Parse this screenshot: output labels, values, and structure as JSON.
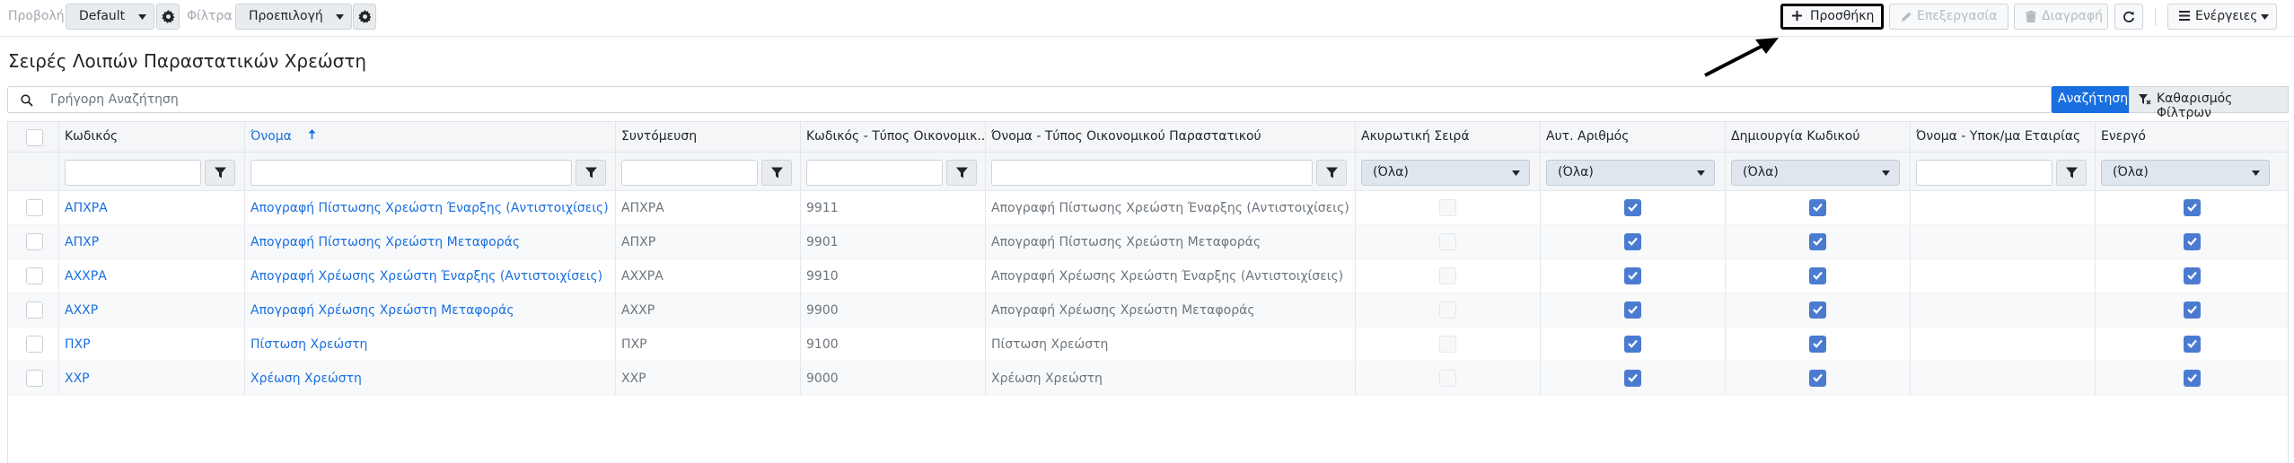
{
  "toolbar": {
    "view_label": "Προβολή",
    "view_value": "Default",
    "filter_label": "Φίλτρα",
    "filter_value": "Προεπιλογή",
    "add_label": "Προσθήκη",
    "edit_label": "Επεξεργασία",
    "delete_label": "Διαγραφή",
    "actions_label": "Ενέργειες"
  },
  "page": {
    "title": "Σειρές Λοιπών Παραστατικών Χρεώστη"
  },
  "search": {
    "placeholder": "Γρήγορη Αναζήτηση",
    "search_button": "Αναζήτηση",
    "clear_button": "Καθαρισμός Φίλτρων"
  },
  "table": {
    "columns": [
      "Κωδικός",
      "Όνομα",
      "Συντόμευση",
      "Κωδικός - Τύπος Οικονομικ...",
      "Όνομα - Τύπος Οικονομικού Παραστατικού",
      "Ακυρωτική Σειρά",
      "Αυτ. Αριθμός",
      "Δημιουργία Κωδικού",
      "Όνομα - Υποκ/μα Εταιρίας",
      "Ενεργό"
    ],
    "select_all_option": "(Όλα)",
    "rows": [
      {
        "code": "ΑΠΧΡΑ",
        "name": "Απογραφή Πίστωσης Χρεώστη Έναρξης (Αντιστοιχίσεις)",
        "short": "ΑΠΧΡΑ",
        "type_code": "9911",
        "type_name": "Απογραφή Πίστωσης Χρεώστη Έναρξης (Αντιστοιχίσεις)",
        "cancel_series": false,
        "auto_number": true,
        "create_code": true,
        "subsidiary": "",
        "active": true
      },
      {
        "code": "ΑΠΧΡ",
        "name": "Απογραφή Πίστωσης Χρεώστη Μεταφοράς",
        "short": "ΑΠΧΡ",
        "type_code": "9901",
        "type_name": "Απογραφή Πίστωσης Χρεώστη Μεταφοράς",
        "cancel_series": false,
        "auto_number": true,
        "create_code": true,
        "subsidiary": "",
        "active": true
      },
      {
        "code": "ΑΧΧΡΑ",
        "name": "Απογραφή Χρέωσης Χρεώστη Έναρξης (Αντιστοιχίσεις)",
        "short": "ΑΧΧΡΑ",
        "type_code": "9910",
        "type_name": "Απογραφή Χρέωσης Χρεώστη Έναρξης (Αντιστοιχίσεις)",
        "cancel_series": false,
        "auto_number": true,
        "create_code": true,
        "subsidiary": "",
        "active": true
      },
      {
        "code": "ΑΧΧΡ",
        "name": "Απογραφή Χρέωσης Χρεώστη Μεταφοράς",
        "short": "ΑΧΧΡ",
        "type_code": "9900",
        "type_name": "Απογραφή Χρέωσης Χρεώστη Μεταφοράς",
        "cancel_series": false,
        "auto_number": true,
        "create_code": true,
        "subsidiary": "",
        "active": true
      },
      {
        "code": "ΠΧΡ",
        "name": "Πίστωση Χρεώστη",
        "short": "ΠΧΡ",
        "type_code": "9100",
        "type_name": "Πίστωση Χρεώστη",
        "cancel_series": false,
        "auto_number": true,
        "create_code": true,
        "subsidiary": "",
        "active": true
      },
      {
        "code": "ΧΧΡ",
        "name": "Χρέωση Χρεώστη",
        "short": "ΧΧΡ",
        "type_code": "9000",
        "type_name": "Χρέωση Χρεώστη",
        "cancel_series": false,
        "auto_number": true,
        "create_code": true,
        "subsidiary": "",
        "active": true
      }
    ]
  },
  "colors": {
    "accent": "#1a6fe0",
    "checkbox_checked": "#4b7bd1"
  },
  "icons": [
    "gear-icon",
    "plus-icon",
    "pencil-icon",
    "trash-icon",
    "refresh-icon",
    "menu-icon",
    "search-icon",
    "filter-icon",
    "filter-clear-icon",
    "sort-asc-icon",
    "check-icon",
    "arrow-icon"
  ]
}
